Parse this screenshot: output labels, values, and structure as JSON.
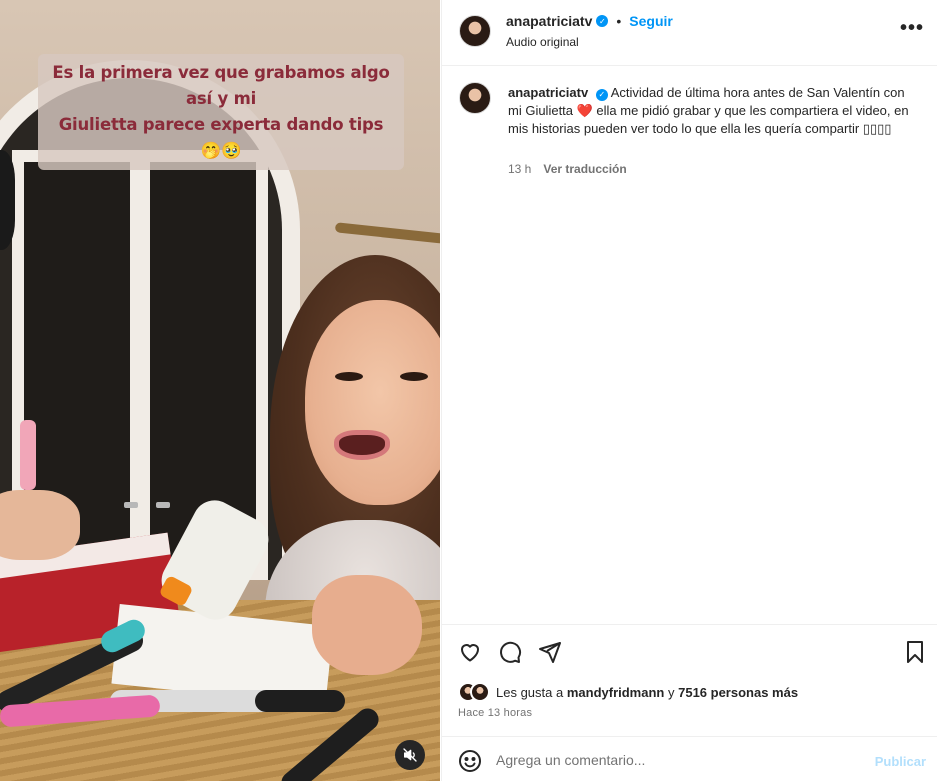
{
  "video": {
    "caption_line1": "Es la primera vez que grabamos algo así y mi",
    "caption_line2": "Giulietta parece experta dando tips 🤭🥹",
    "mute_icon": "speaker-muted-icon"
  },
  "header": {
    "username": "anapatriciatv",
    "separator": "•",
    "follow_label": "Seguir",
    "audio_label": "Audio original",
    "more_label": "•••"
  },
  "post": {
    "username": "anapatriciatv",
    "caption": "Actividad de última hora antes de San Valentín con mi Giulietta ❤️ ella me pidió grabar y que les compartiera el video, en mis historias pueden ver todo lo que ella les quería compartir ▯▯▯▯",
    "time": "13 h",
    "translate_label": "Ver traducción"
  },
  "actions": {
    "like_icon": "heart-icon",
    "comment_icon": "comment-bubble-icon",
    "share_icon": "paper-plane-icon",
    "save_icon": "bookmark-icon"
  },
  "likes": {
    "prefix": "Les gusta a",
    "first_user": "mandyfridmann",
    "conjunction": "y",
    "others": "7516 personas más"
  },
  "time_ago": "Hace 13 horas",
  "comment_box": {
    "placeholder": "Agrega un comentario...",
    "publish_label": "Publicar",
    "emoji_icon": "smiley-icon"
  },
  "colors": {
    "accent": "#0095f6",
    "caption_text": "#8b2b3a",
    "publish_disabled": "#b2dffc"
  }
}
